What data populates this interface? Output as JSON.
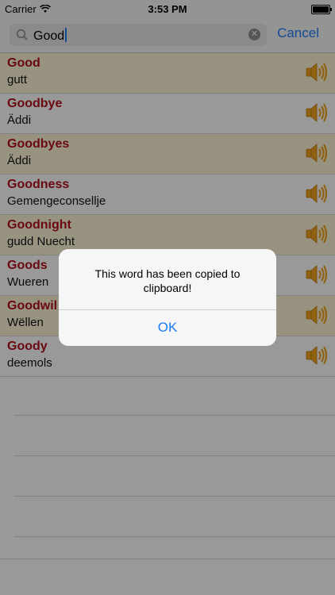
{
  "status": {
    "carrier": "Carrier",
    "time": "3:53 PM",
    "battery_fraction": 1.0
  },
  "search": {
    "value": "Good",
    "cancel_label": "Cancel"
  },
  "results": [
    {
      "word": "Good",
      "translation": "gutt"
    },
    {
      "word": "Goodbye",
      "translation": "Äddi"
    },
    {
      "word": "Goodbyes",
      "translation": "Äddi"
    },
    {
      "word": "Goodness",
      "translation": "Gemengeconsellje"
    },
    {
      "word": "Goodnight",
      "translation": "gudd Nuecht"
    },
    {
      "word": "Goods",
      "translation": "Wueren"
    },
    {
      "word": "Goodwil",
      "translation": "Wëllen"
    },
    {
      "word": "Goody",
      "translation": "deemols"
    }
  ],
  "alert": {
    "message": "This word has been copied to clipboard!",
    "ok_label": "OK"
  },
  "colors": {
    "accent": "#1a7cf5",
    "word": "#b10f1c",
    "row_highlight": "#fdf6d8",
    "speaker": "#f0a21c"
  },
  "icons": {
    "speaker": "speaker-icon",
    "search": "search-icon",
    "clear": "clear-icon"
  }
}
